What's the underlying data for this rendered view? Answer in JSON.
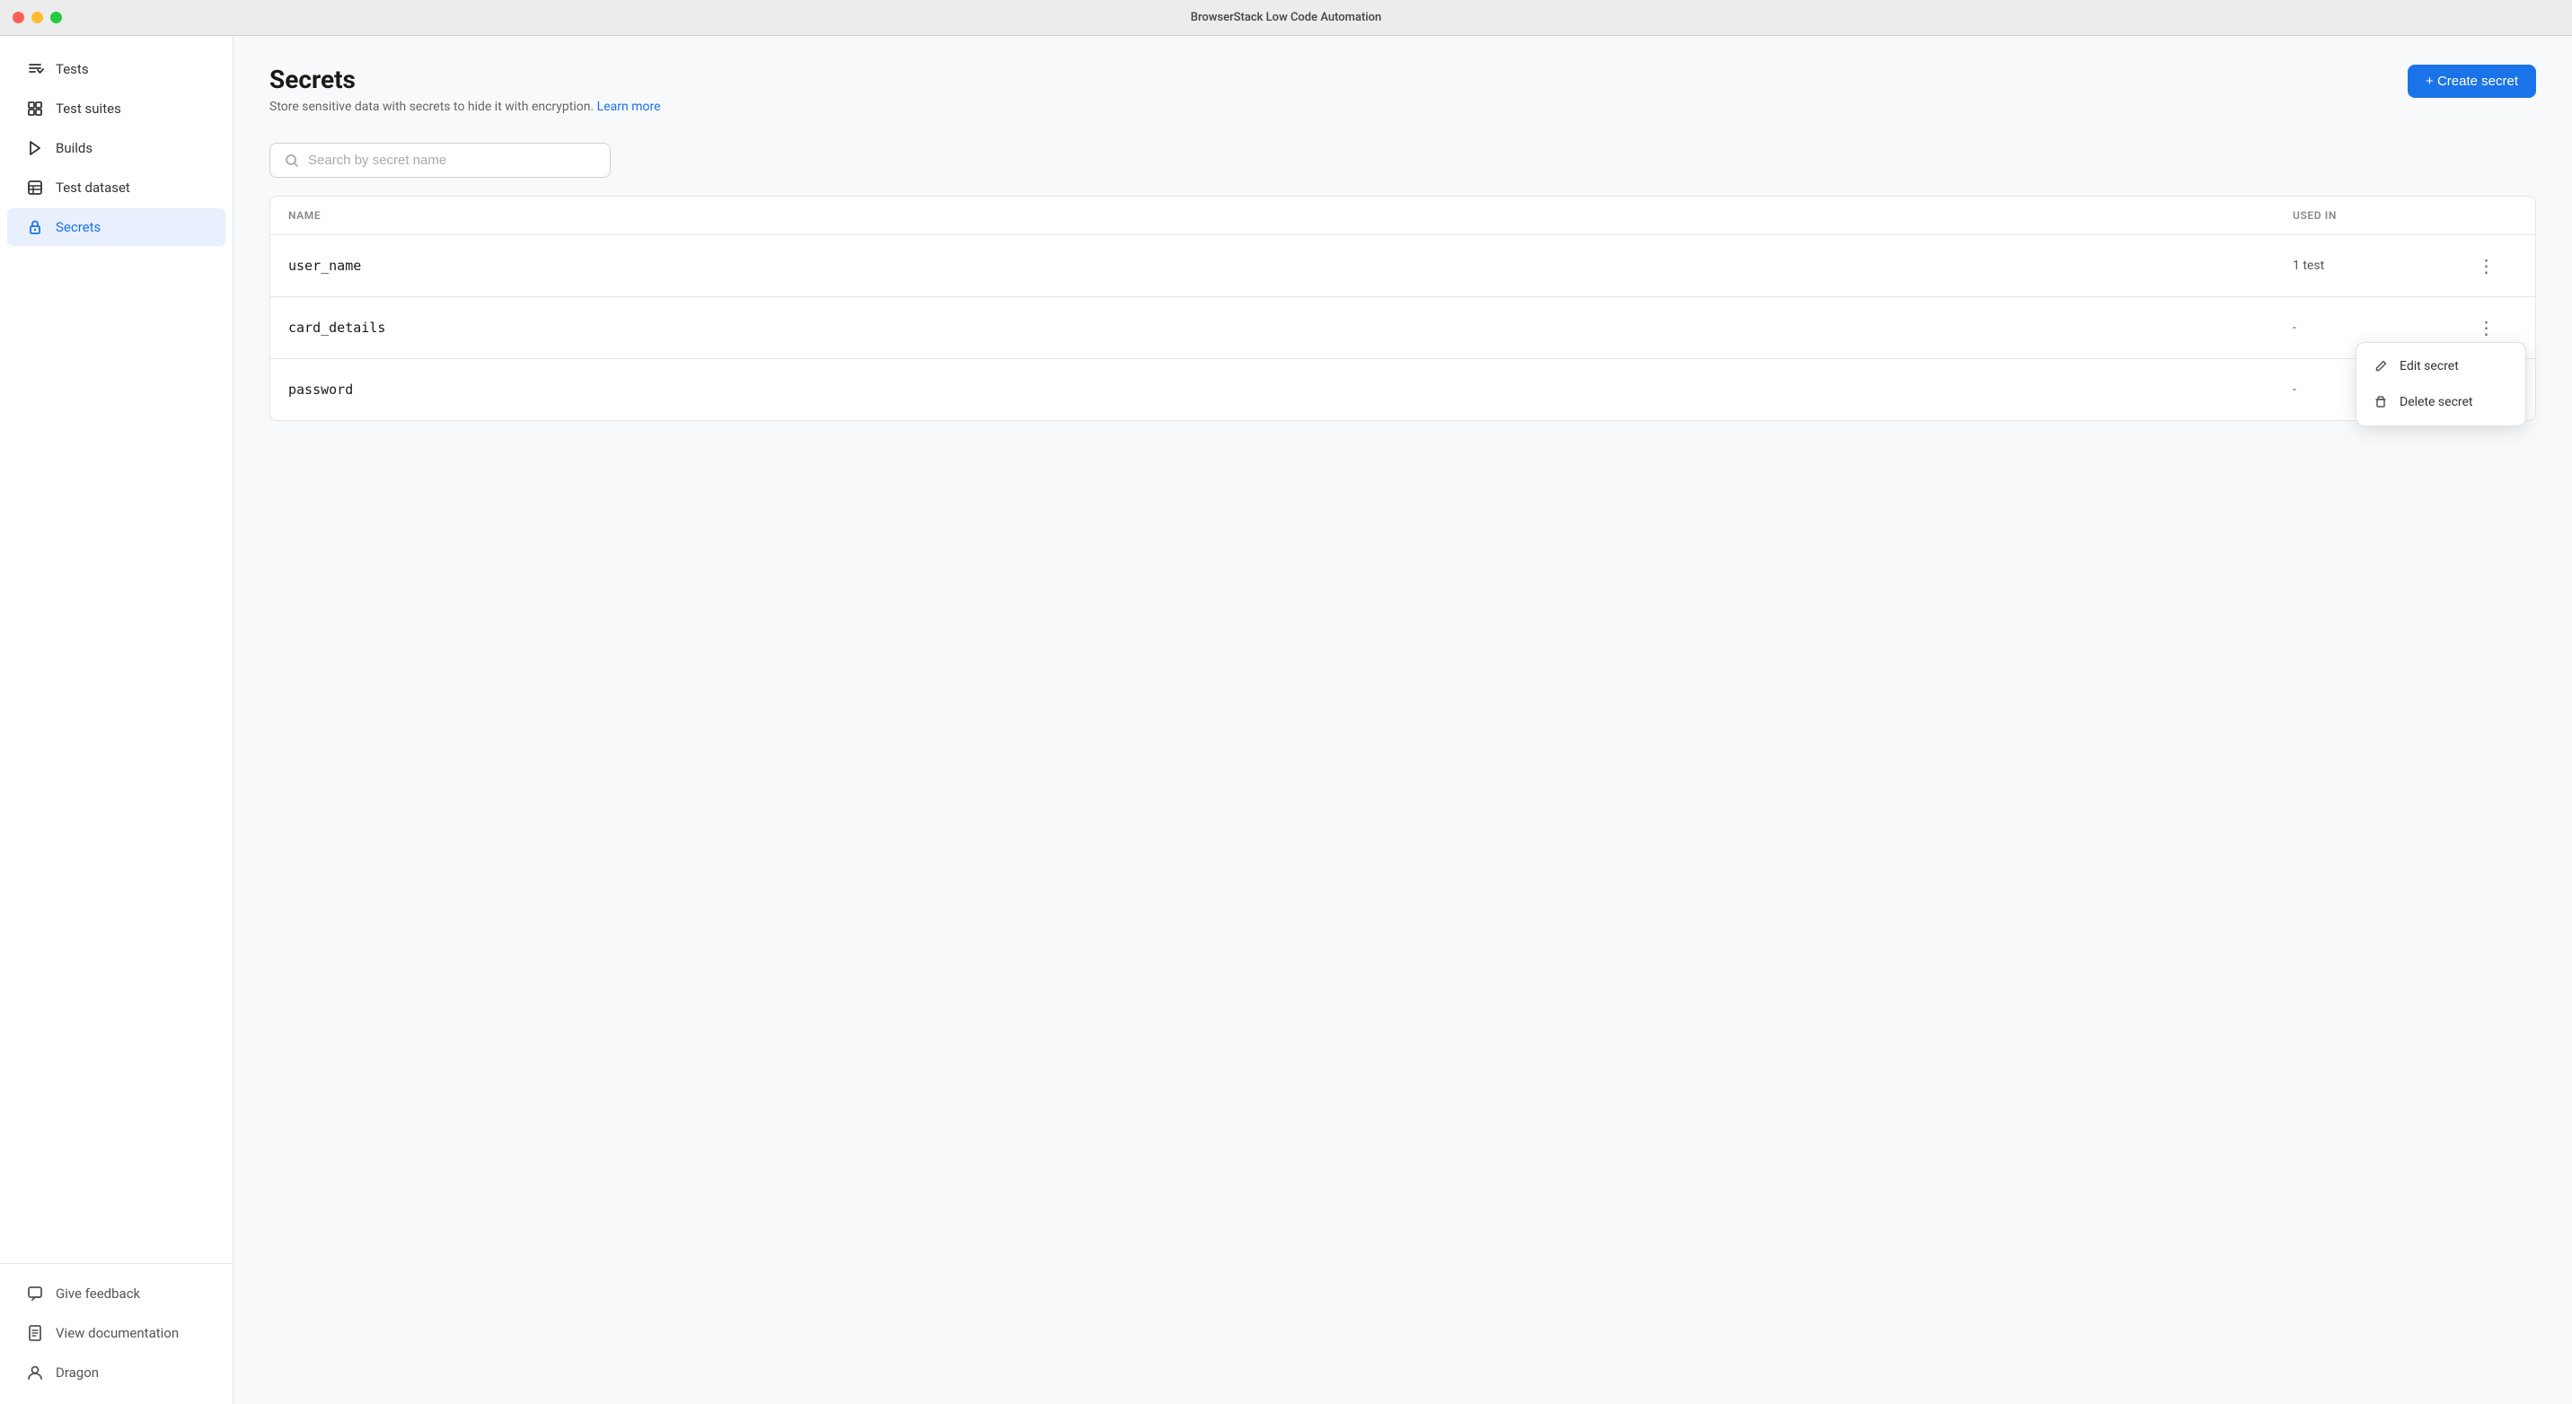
{
  "titleBar": {
    "title": "BrowserStack Low Code Automation"
  },
  "sidebar": {
    "items": [
      {
        "id": "tests",
        "label": "Tests",
        "icon": "tests-icon",
        "active": false
      },
      {
        "id": "test-suites",
        "label": "Test suites",
        "icon": "test-suites-icon",
        "active": false
      },
      {
        "id": "builds",
        "label": "Builds",
        "icon": "builds-icon",
        "active": false
      },
      {
        "id": "test-dataset",
        "label": "Test dataset",
        "icon": "test-dataset-icon",
        "active": false
      },
      {
        "id": "secrets",
        "label": "Secrets",
        "icon": "secrets-icon",
        "active": true
      }
    ],
    "bottomItems": [
      {
        "id": "give-feedback",
        "label": "Give feedback",
        "icon": "feedback-icon"
      },
      {
        "id": "view-documentation",
        "label": "View documentation",
        "icon": "documentation-icon"
      }
    ],
    "user": {
      "name": "Dragon",
      "icon": "user-icon"
    }
  },
  "page": {
    "title": "Secrets",
    "subtitle": "Store sensitive data with secrets to hide it with encryption.",
    "learnMoreLabel": "Learn more",
    "createButtonLabel": "+ Create secret"
  },
  "search": {
    "placeholder": "Search by secret name"
  },
  "table": {
    "columns": [
      {
        "key": "name",
        "label": "NAME"
      },
      {
        "key": "usedIn",
        "label": "USED IN"
      }
    ],
    "rows": [
      {
        "id": "row-1",
        "name": "user_name",
        "usedIn": "1 test",
        "showMenu": false
      },
      {
        "id": "row-2",
        "name": "card_details",
        "usedIn": "-",
        "showMenu": true
      },
      {
        "id": "row-3",
        "name": "password",
        "usedIn": "-",
        "showMenu": false
      }
    ]
  },
  "contextMenu": {
    "items": [
      {
        "id": "edit-secret",
        "label": "Edit secret",
        "icon": "edit-icon"
      },
      {
        "id": "delete-secret",
        "label": "Delete secret",
        "icon": "delete-icon"
      }
    ]
  }
}
